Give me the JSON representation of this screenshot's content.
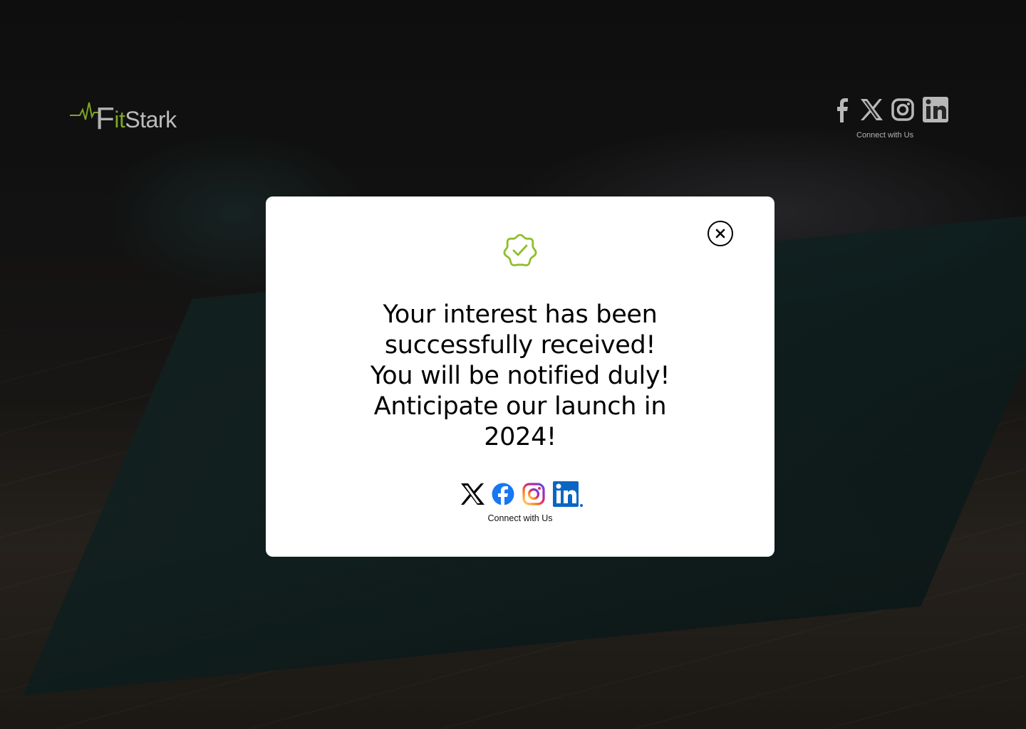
{
  "brand": {
    "logo_prefix": "F",
    "logo_it": "it",
    "logo_rest": "Stark",
    "accent_color": "#8fbf2a"
  },
  "header": {
    "social_icons": [
      "facebook-icon",
      "x-icon",
      "instagram-icon",
      "linkedin-icon"
    ],
    "connect_label": "Connect with Us"
  },
  "modal": {
    "badge_icon": "verified-check-icon",
    "badge_color": "#8fbf2a",
    "message_lines": [
      "Your interest has been",
      "successfully received!",
      "You will be notified duly!",
      "Anticipate our launch in",
      "2024!"
    ],
    "close_icon": "close-icon",
    "social_icons": [
      "x-icon",
      "facebook-icon",
      "instagram-icon",
      "linkedin-icon"
    ],
    "connect_label": "Connect with Us"
  }
}
